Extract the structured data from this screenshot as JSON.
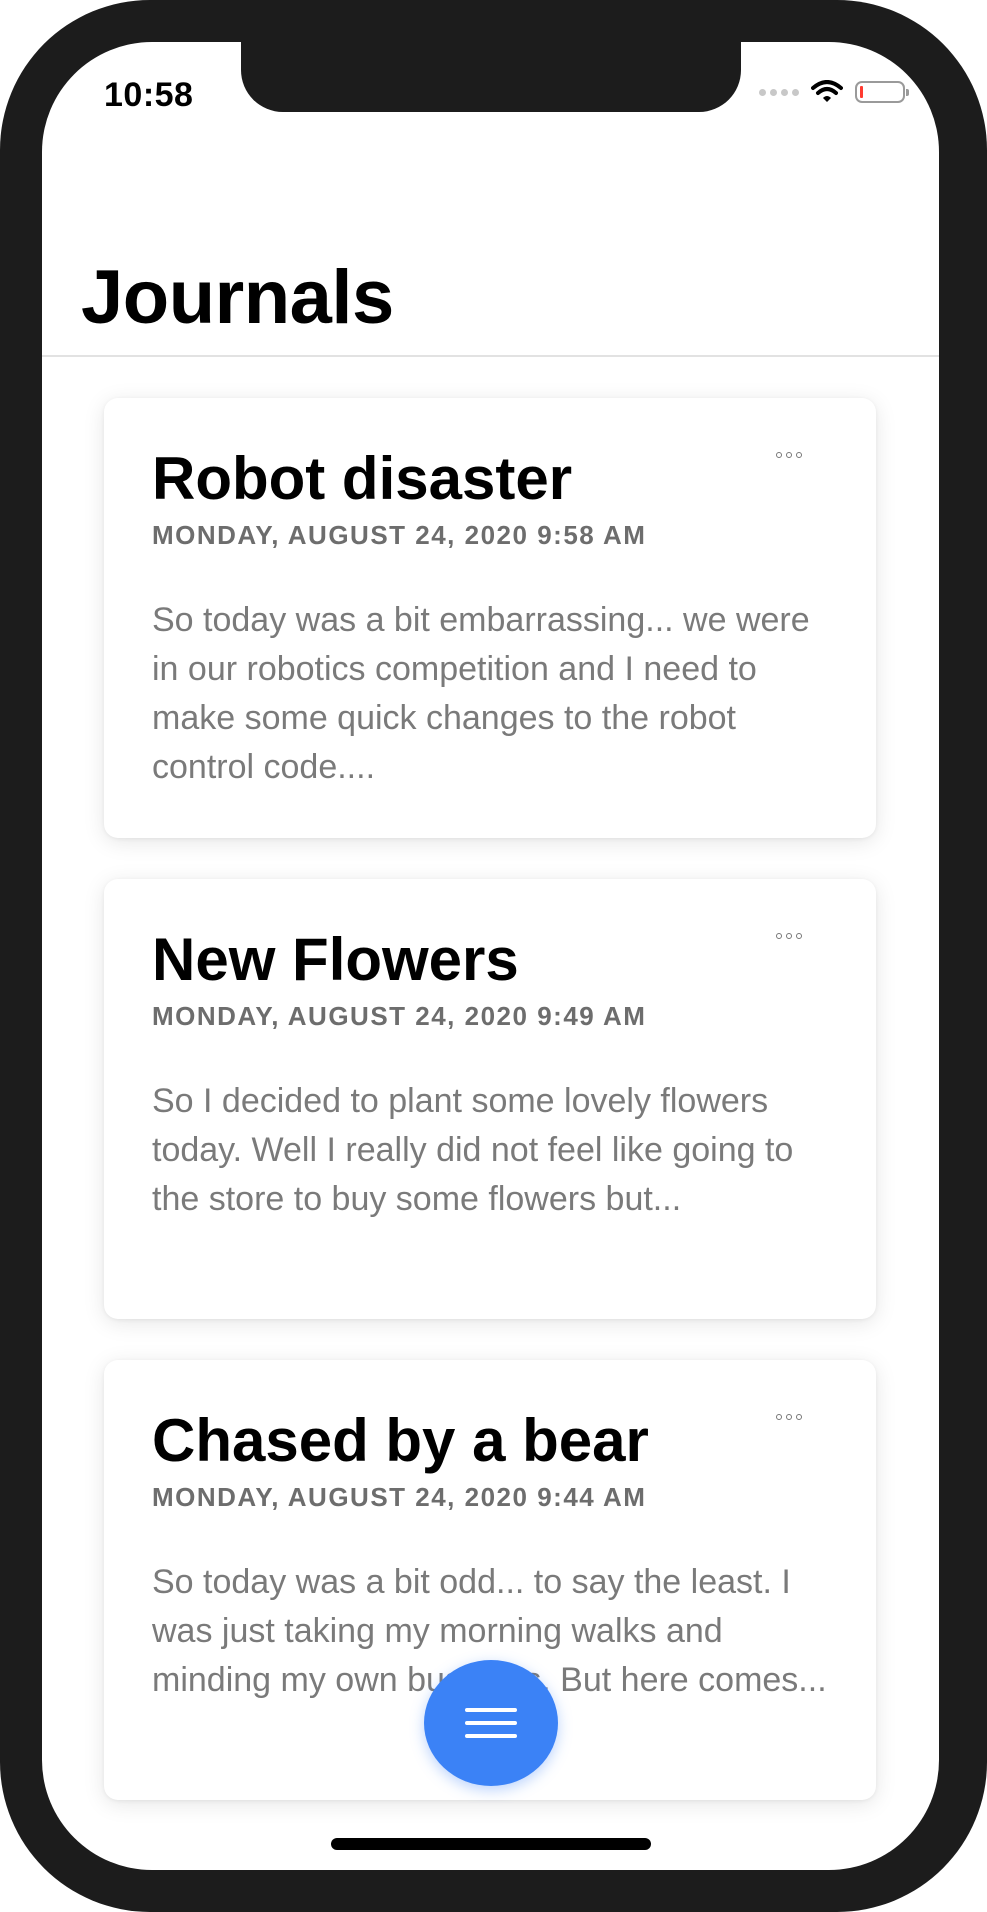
{
  "status_bar": {
    "time": "10:58"
  },
  "header": {
    "title": "Journals"
  },
  "journals": [
    {
      "title": "Robot disaster",
      "date": "MONDAY, AUGUST 24, 2020 9:58 AM",
      "preview": "So today was a bit embarrassing... we were in our robotics competition and I need to make some quick changes to the robot control code...."
    },
    {
      "title": "New Flowers",
      "date": "MONDAY, AUGUST 24, 2020 9:49 AM",
      "preview": "So I decided to plant some lovely flowers today. Well I really did not feel like going to the store to buy some flowers but..."
    },
    {
      "title": "Chased by a bear",
      "date": "MONDAY, AUGUST 24, 2020 9:44 AM",
      "preview": "So today was a bit odd... to say the least. I was just taking my morning walks and minding my own business. But here comes..."
    }
  ],
  "icons": {
    "more": "more-horizontal-icon",
    "fab": "menu-icon",
    "wifi": "wifi-icon",
    "battery": "battery-icon",
    "signal": "cellular-signal-icon"
  },
  "colors": {
    "accent": "#3b82f6",
    "battery_low": "#ff3b30"
  },
  "battery_level": 0.05
}
